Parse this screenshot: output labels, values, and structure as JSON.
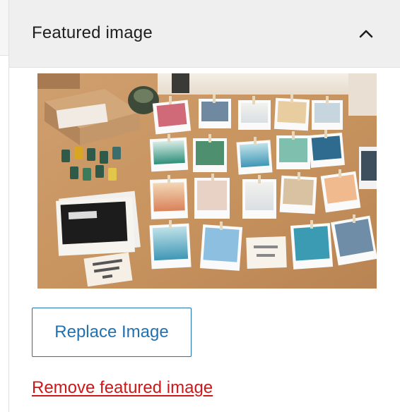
{
  "panel": {
    "title": "Featured image",
    "toggle_icon": "chevron-up-icon",
    "expanded": true
  },
  "featured_image": {
    "description_visible": false
  },
  "actions": {
    "replace_label": "Replace Image",
    "remove_label": "Remove featured image"
  },
  "colors": {
    "accent": "#2271b1",
    "destructive": "#cc1818",
    "header_bg": "#efefef"
  }
}
